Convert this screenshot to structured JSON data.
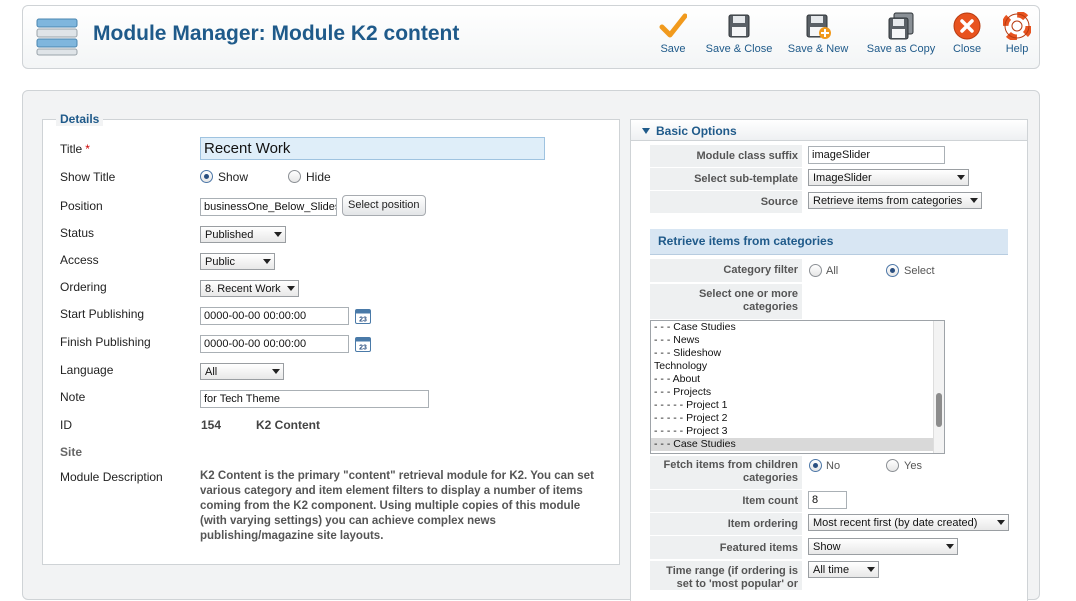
{
  "header": {
    "title": "Module Manager: Module K2 content"
  },
  "toolbar": {
    "save": "Save",
    "save_close": "Save & Close",
    "save_new": "Save & New",
    "save_copy": "Save as Copy",
    "close": "Close",
    "help": "Help"
  },
  "details": {
    "legend": "Details",
    "title_label": "Title",
    "title_required": "*",
    "title_value": "Recent Work",
    "show_title_label": "Show Title",
    "show_title_options": [
      "Show",
      "Hide"
    ],
    "show_title_selected": "Show",
    "position_label": "Position",
    "position_value": "businessOne_Below_Slidesh",
    "position_button": "Select position",
    "status_label": "Status",
    "status_value": "Published",
    "access_label": "Access",
    "access_value": "Public",
    "ordering_label": "Ordering",
    "ordering_value": "8. Recent Work",
    "start_label": "Start Publishing",
    "start_value": "0000-00-00 00:00:00",
    "finish_label": "Finish Publishing",
    "finish_value": "0000-00-00 00:00:00",
    "calendar_text": "23",
    "language_label": "Language",
    "language_value": "All",
    "note_label": "Note",
    "note_value": "for Tech Theme",
    "id_label": "ID",
    "id_value": "154",
    "id_type": "K2 Content",
    "site_label": "Site",
    "module_desc_label": "Module Description",
    "module_desc": "K2 Content is the primary \"content\" retrieval module for K2. You can set various category and item element filters to display a number of items coming from the K2 component. Using multiple copies of this module (with varying settings) you can achieve complex news publishing/magazine site layouts."
  },
  "basic": {
    "header": "Basic Options",
    "class_suffix_label": "Module class suffix",
    "class_suffix_value": "imageSlider",
    "subtemplate_label": "Select sub-template",
    "subtemplate_value": "ImageSlider",
    "source_label": "Source",
    "source_value": "Retrieve items from categories",
    "retrieve_header": "Retrieve items from categories",
    "category_filter_label": "Category filter",
    "category_filter_options": [
      "All",
      "Select"
    ],
    "category_filter_selected": "Select",
    "select_categories_label_1": "Select one or more",
    "select_categories_label_2": "categories",
    "categories": [
      "- - - Case Studies",
      "- - - News",
      "- - - Slideshow",
      "Technology",
      "- - - About",
      "- - - Projects",
      "- - - - - Project 1",
      "- - - - - Project 2",
      "- - - - - Project 3",
      "- - - Case Studies"
    ],
    "categories_selected_index": 9,
    "children_label_1": "Fetch items from children",
    "children_label_2": "categories",
    "children_options": [
      "No",
      "Yes"
    ],
    "children_selected": "No",
    "item_count_label": "Item count",
    "item_count_value": "8",
    "item_ordering_label": "Item ordering",
    "item_ordering_value": "Most recent first (by date created)",
    "featured_label": "Featured items",
    "featured_value": "Show",
    "time_range_label_1": "Time range (if ordering is",
    "time_range_label_2": "set to 'most popular' or",
    "time_range_value": "All time"
  }
}
